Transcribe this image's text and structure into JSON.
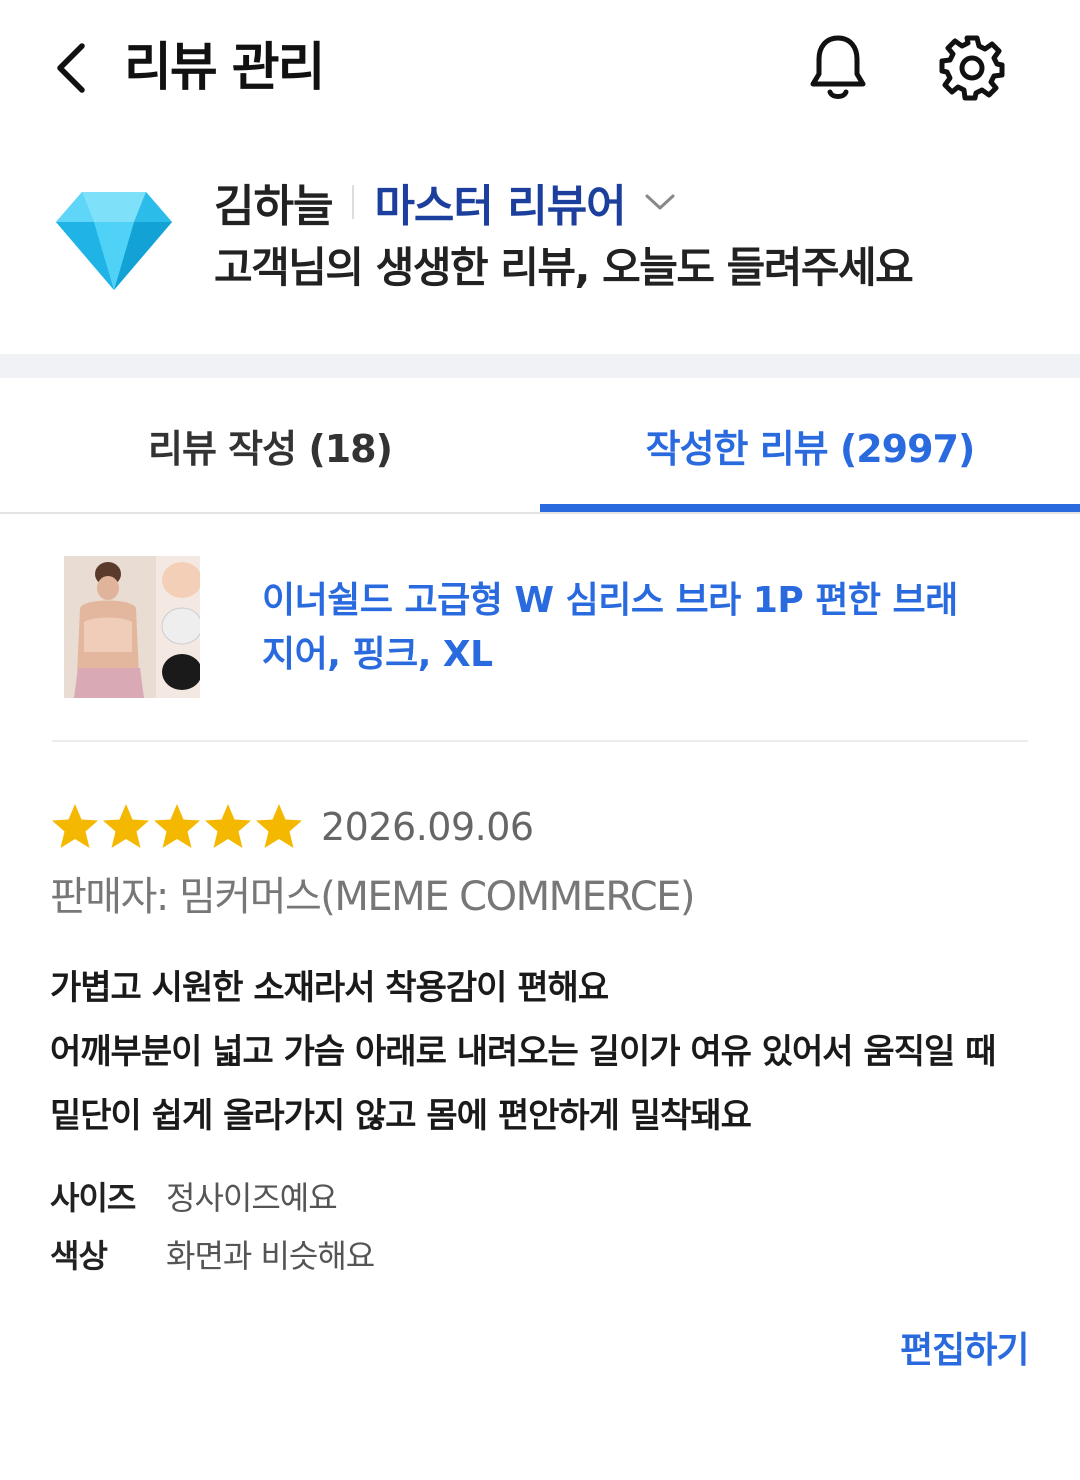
{
  "header": {
    "title": "리뷰 관리",
    "back_icon": "chevron-left-icon",
    "notification_icon": "bell-icon",
    "settings_icon": "gear-icon"
  },
  "profile": {
    "badge_icon": "diamond-icon",
    "name": "김하늘",
    "grade": "마스터 리뷰어",
    "subtitle": "고객님의 생생한 리뷰, 오늘도 들려주세요"
  },
  "tabs": [
    {
      "label": "리뷰 작성 (18)",
      "active": false
    },
    {
      "label": "작성한 리뷰 (2997)",
      "active": true
    }
  ],
  "product": {
    "name": "이너쉴드 고급형 W 심리스 브라 1P 편한 브래지어, 핑크, XL"
  },
  "review": {
    "rating": 5,
    "max_rating": 5,
    "date": "2026.09.06",
    "seller": "판매자: 밈커머스(MEME COMMERCE)",
    "body_lines": [
      "가볍고 시원한 소재라서 착용감이 편해요",
      "어깨부분이 넓고 가슴 아래로 내려오는 길이가 여유 있어서 움직일 때",
      "밑단이 쉽게 올라가지 않고 몸에 편안하게 밀착돼요"
    ],
    "attributes": [
      {
        "label": "사이즈",
        "value": "정사이즈예요"
      },
      {
        "label": "색상",
        "value": "화면과 비슷해요"
      }
    ],
    "edit_label": "편집하기"
  },
  "colors": {
    "accent": "#2a6adf",
    "grade": "#1c3f9e",
    "star": "#f5b800",
    "divider_band": "#f0f2f5"
  }
}
